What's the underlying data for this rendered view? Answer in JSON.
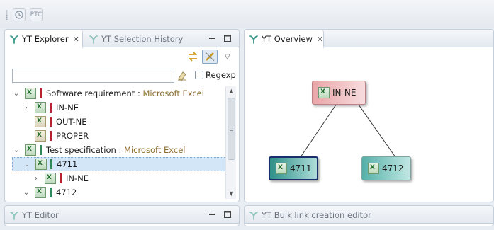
{
  "toolbar": {
    "items": [
      {
        "icon": "clock-icon"
      },
      {
        "icon": "ptc-icon",
        "label": "PTC"
      }
    ]
  },
  "explorer_panel": {
    "tabs": [
      {
        "label": "YT Explorer",
        "active": true,
        "icon": "yt-icon",
        "closable": true
      },
      {
        "label": "YT Selection History",
        "active": false,
        "icon": "yt-icon"
      }
    ],
    "filter": {
      "value": "",
      "placeholder": ""
    },
    "regexp_label": "Regexp",
    "regexp_checked": false,
    "tree": [
      {
        "indent": 0,
        "expander": "⌄",
        "icon": "excel-icon",
        "bar": "red",
        "label": "Software requirement",
        "source": "Microsoft Excel"
      },
      {
        "indent": 1,
        "expander": "›",
        "icon": "excel-icon",
        "bar": "red",
        "label": "IN-NE"
      },
      {
        "indent": 1,
        "expander": "",
        "icon": "excel-broken-icon",
        "bar": "red",
        "label": "OUT-NE"
      },
      {
        "indent": 1,
        "expander": "",
        "icon": "excel-broken-icon",
        "bar": "red",
        "label": "PROPER"
      },
      {
        "indent": 0,
        "expander": "⌄",
        "icon": "excel-icon",
        "bar": "green",
        "label": "Test specification",
        "source": "Microsoft Excel"
      },
      {
        "indent": 1,
        "expander": "⌄",
        "icon": "excel-icon",
        "bar": "green",
        "label": "4711",
        "selected": true
      },
      {
        "indent": 2,
        "expander": "›",
        "icon": "excel-icon",
        "bar": "red",
        "label": "IN-NE"
      },
      {
        "indent": 1,
        "expander": "⌄",
        "icon": "excel-icon",
        "bar": "green",
        "label": "4712"
      }
    ],
    "source_sep": " : "
  },
  "overview_panel": {
    "tab": {
      "label": "YT Overview",
      "icon": "yt-icon",
      "closable": true
    },
    "nodes": [
      {
        "id": "in-ne",
        "label": "IN-NE"
      },
      {
        "id": "4711",
        "label": "4711"
      },
      {
        "id": "4712",
        "label": "4712"
      }
    ],
    "edges": [
      [
        "in-ne",
        "4711"
      ],
      [
        "in-ne",
        "4712"
      ]
    ]
  },
  "bottom_left_panel": {
    "tab": {
      "label": "YT Editor",
      "icon": "yt-icon"
    }
  },
  "bottom_right_panel": {
    "tab": {
      "label": "YT Bulk link creation editor",
      "icon": "yt-icon"
    }
  },
  "colors": {
    "requirement_bar": "#b8202f",
    "test_bar": "#2e8b57",
    "node_in_ne": "#e9a5a8",
    "node_4711": "#2e8f86",
    "node_4712": "#56b0a8",
    "selection": "#d3e6f7"
  }
}
